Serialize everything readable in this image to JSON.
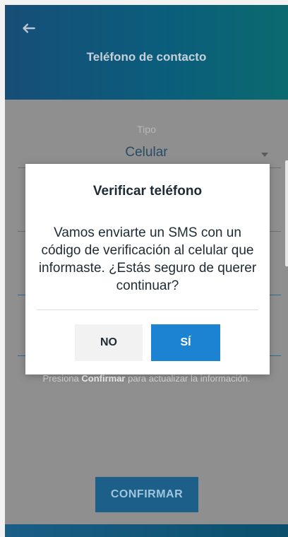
{
  "header": {
    "back_icon": "arrow-left-icon",
    "title": "Teléfono de contacto"
  },
  "form": {
    "field_label": "Tipo",
    "field_value": "Celular",
    "dropdown_icon": "triangle-down-icon"
  },
  "footer": {
    "text_prefix": "Presiona ",
    "text_bold": "Confirmar",
    "text_suffix": " para actualizar la información."
  },
  "actions": {
    "confirm_label": "CONFIRMAR"
  },
  "dialog": {
    "title": "Verificar teléfono",
    "message": "Vamos enviarte un SMS con un código de verificación al celular que informaste. ¿Estás seguro de querer continuar?",
    "no_label": "NO",
    "yes_label": "SÍ"
  },
  "colors": {
    "header_gradient_start": "#164e78",
    "header_gradient_end": "#0b6a6f",
    "primary_button": "#1b83d1",
    "confirm_button": "#1c5f88"
  }
}
